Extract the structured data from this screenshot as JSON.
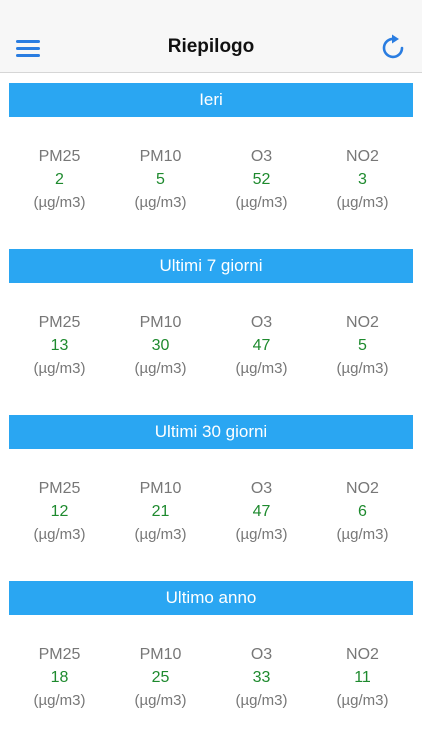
{
  "header": {
    "title": "Riepilogo"
  },
  "colors": {
    "accent": "#2aa6f2",
    "value_green": "#1e8a2e",
    "label_gray": "#777777"
  },
  "icons": {
    "menu": "hamburger-menu-icon",
    "refresh": "refresh-icon"
  },
  "sections": [
    {
      "title": "Ieri",
      "metrics": [
        {
          "name": "PM25",
          "value": "2",
          "unit": "(µg/m3)"
        },
        {
          "name": "PM10",
          "value": "5",
          "unit": "(µg/m3)"
        },
        {
          "name": "O3",
          "value": "52",
          "unit": "(µg/m3)"
        },
        {
          "name": "NO2",
          "value": "3",
          "unit": "(µg/m3)"
        }
      ]
    },
    {
      "title": "Ultimi 7 giorni",
      "metrics": [
        {
          "name": "PM25",
          "value": "13",
          "unit": "(µg/m3)"
        },
        {
          "name": "PM10",
          "value": "30",
          "unit": "(µg/m3)"
        },
        {
          "name": "O3",
          "value": "47",
          "unit": "(µg/m3)"
        },
        {
          "name": "NO2",
          "value": "5",
          "unit": "(µg/m3)"
        }
      ]
    },
    {
      "title": "Ultimi 30 giorni",
      "metrics": [
        {
          "name": "PM25",
          "value": "12",
          "unit": "(µg/m3)"
        },
        {
          "name": "PM10",
          "value": "21",
          "unit": "(µg/m3)"
        },
        {
          "name": "O3",
          "value": "47",
          "unit": "(µg/m3)"
        },
        {
          "name": "NO2",
          "value": "6",
          "unit": "(µg/m3)"
        }
      ]
    },
    {
      "title": "Ultimo anno",
      "metrics": [
        {
          "name": "PM25",
          "value": "18",
          "unit": "(µg/m3)"
        },
        {
          "name": "PM10",
          "value": "25",
          "unit": "(µg/m3)"
        },
        {
          "name": "O3",
          "value": "33",
          "unit": "(µg/m3)"
        },
        {
          "name": "NO2",
          "value": "11",
          "unit": "(µg/m3)"
        }
      ]
    }
  ]
}
